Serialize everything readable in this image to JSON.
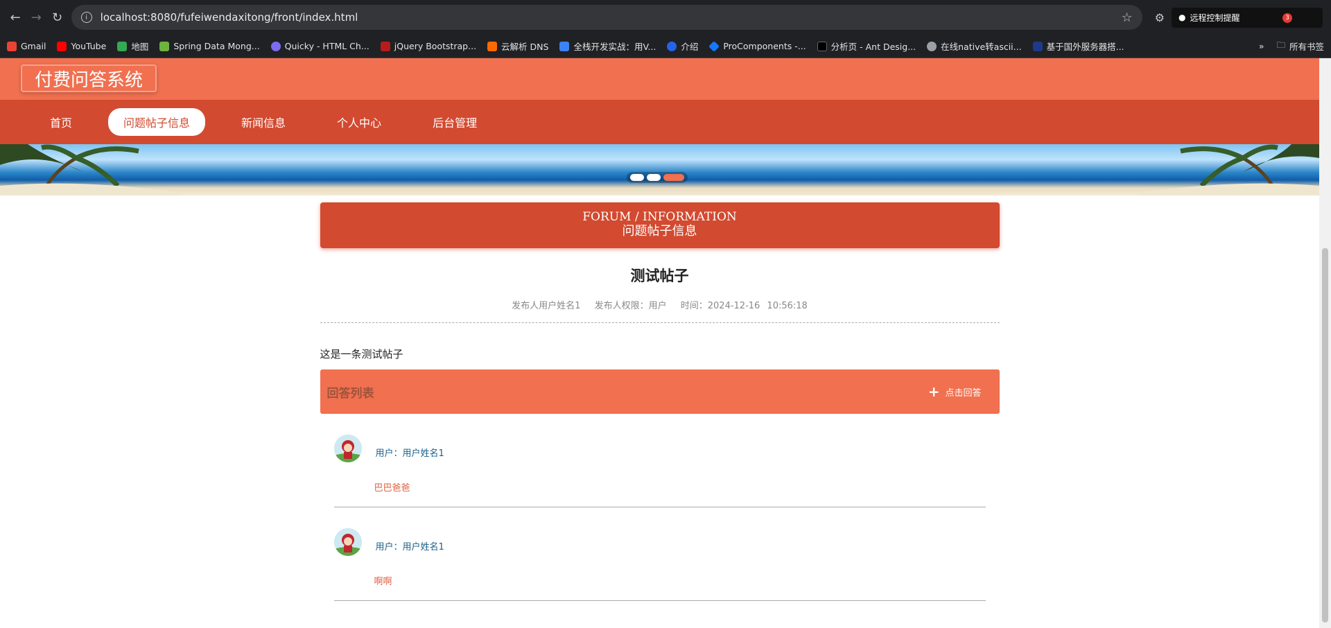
{
  "browser": {
    "url": "localhost:8080/fufeiwendaxitong/front/index.html",
    "remote_label": "远程控制提醒",
    "remote_badge": "3",
    "bookmarks": [
      {
        "label": "Gmail",
        "color": "#ea4335"
      },
      {
        "label": "YouTube",
        "color": "#ff0000"
      },
      {
        "label": "地图",
        "color": "#34a853"
      },
      {
        "label": "Spring Data Mong...",
        "color": "#6db33f"
      },
      {
        "label": "Quicky - HTML Ch...",
        "color": "#7c6cf0"
      },
      {
        "label": "jQuery Bootstrap...",
        "color": "#b71c1c"
      },
      {
        "label": "云解析 DNS",
        "color": "#ff6a00"
      },
      {
        "label": "全栈开发实战：用V...",
        "color": "#3b82f6"
      },
      {
        "label": "介绍",
        "color": "#2563eb"
      },
      {
        "label": "ProComponents -...",
        "color": "#1677ff"
      },
      {
        "label": "分析页 - Ant Desig...",
        "color": "#000000"
      },
      {
        "label": "在线native转ascii...",
        "color": "#9aa0a6"
      },
      {
        "label": "基于国外服务器搭...",
        "color": "#1e3a8a"
      }
    ],
    "all_bookmarks": "所有书签"
  },
  "site": {
    "logo": "付费问答系统",
    "menu": [
      {
        "label": "首页",
        "active": false
      },
      {
        "label": "问题帖子信息",
        "active": true
      },
      {
        "label": "新闻信息",
        "active": false
      },
      {
        "label": "个人中心",
        "active": false
      },
      {
        "label": "后台管理",
        "active": false
      }
    ],
    "primary_color": "#f07050",
    "menu_color": "#d24a30"
  },
  "section": {
    "title_en": "FORUM / INFORMATION",
    "title_cn": "问题帖子信息"
  },
  "post": {
    "title": "测试帖子",
    "author": "发布人用户姓名1",
    "role": "发布人权限：用户",
    "time": "时间：2024-12-16 10:56:18",
    "body": "这是一条测试帖子"
  },
  "answers": {
    "header": "回答列表",
    "reply_label": "点击回答",
    "items": [
      {
        "user": "用户：用户姓名1",
        "text": "巴巴爸爸"
      },
      {
        "user": "用户：用户姓名1",
        "text": "啊啊"
      }
    ]
  }
}
